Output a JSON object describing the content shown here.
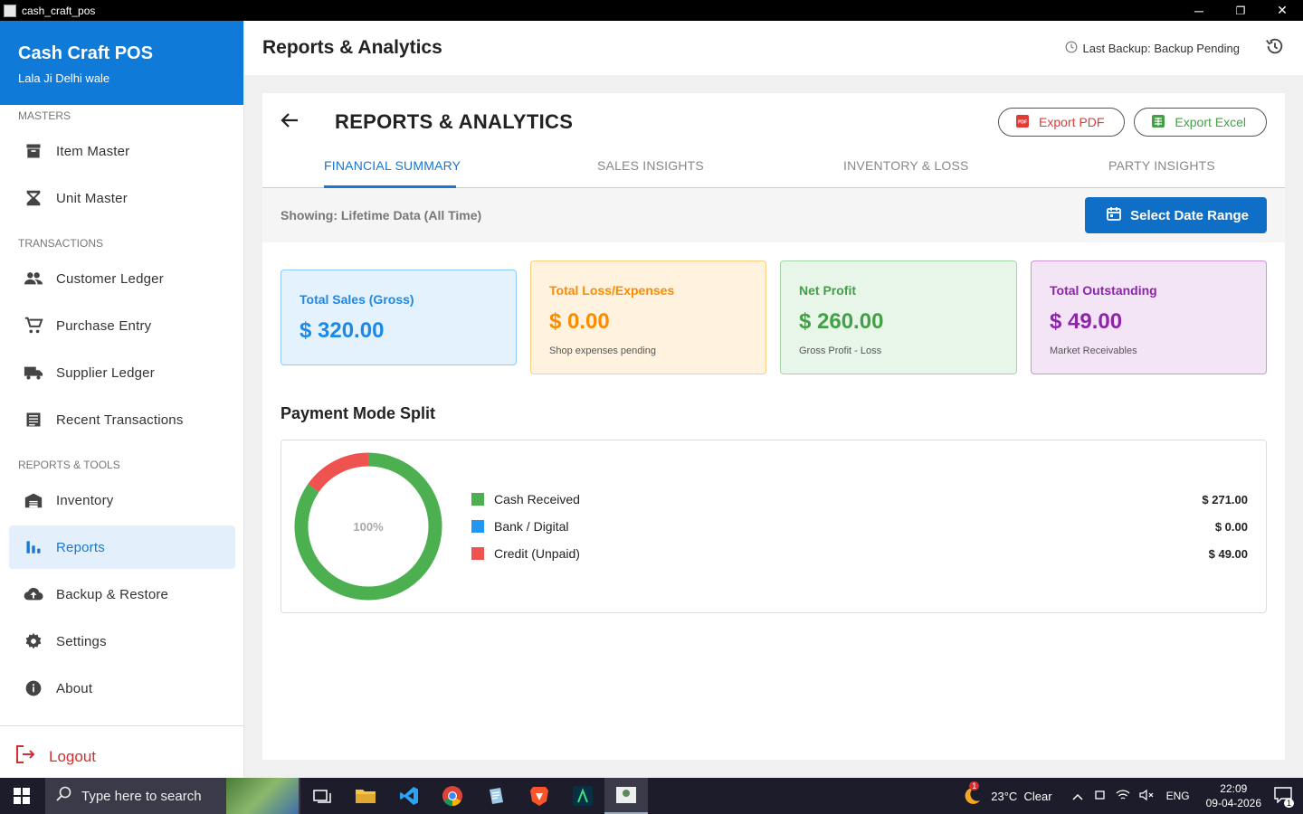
{
  "window": {
    "title": "cash_craft_pos",
    "minimize_label": "─",
    "restore_label": "❐",
    "close_label": "✕"
  },
  "sidebar": {
    "app_name": "Cash Craft POS",
    "shop_name": "Lala Ji Delhi wale",
    "sections": {
      "masters": "MASTERS",
      "transactions": "TRANSACTIONS",
      "reports_tools": "REPORTS & TOOLS"
    },
    "items": [
      {
        "label": "Item Master",
        "icon": "archive-icon"
      },
      {
        "label": "Unit Master",
        "icon": "scale-icon"
      },
      {
        "label": "Customer Ledger",
        "icon": "people-icon"
      },
      {
        "label": "Purchase Entry",
        "icon": "cart-icon"
      },
      {
        "label": "Supplier Ledger",
        "icon": "truck-icon"
      },
      {
        "label": "Recent Transactions",
        "icon": "list-icon"
      },
      {
        "label": "Inventory",
        "icon": "warehouse-icon"
      },
      {
        "label": "Reports",
        "icon": "bar-chart-icon"
      },
      {
        "label": "Backup & Restore",
        "icon": "cloud-upload-icon"
      },
      {
        "label": "Settings",
        "icon": "gear-icon"
      },
      {
        "label": "About",
        "icon": "info-icon"
      }
    ],
    "active_item": "Reports",
    "logout_label": "Logout"
  },
  "header": {
    "title": "Reports & Analytics",
    "backup_status": "Last Backup: Backup Pending"
  },
  "panel": {
    "title": "REPORTS & ANALYTICS",
    "export_pdf": "Export PDF",
    "export_excel": "Export Excel",
    "tabs": [
      "FINANCIAL SUMMARY",
      "SALES INSIGHTS",
      "INVENTORY & LOSS",
      "PARTY INSIGHTS"
    ],
    "active_tab": "FINANCIAL SUMMARY",
    "showing": "Showing: Lifetime Data (All Time)",
    "date_range_label": "Select Date Range"
  },
  "cards": [
    {
      "label": "Total Sales (Gross)",
      "value": "$ 320.00",
      "note": "",
      "color": "#1e88e5",
      "bg": "#e3f2fd",
      "border": "#90caf9"
    },
    {
      "label": "Total Loss/Expenses",
      "value": "$ 0.00",
      "note": "Shop expenses pending",
      "color": "#fb8c00",
      "bg": "#fff3e0",
      "border": "#ffcc80"
    },
    {
      "label": "Net Profit",
      "value": "$ 260.00",
      "note": "Gross Profit - Loss",
      "color": "#43a047",
      "bg": "#e8f5e9",
      "border": "#a5d6a7"
    },
    {
      "label": "Total Outstanding",
      "value": "$ 49.00",
      "note": "Market Receivables",
      "color": "#8e24aa",
      "bg": "#f3e5f5",
      "border": "#ce93d8"
    }
  ],
  "payment_split": {
    "title": "Payment Mode Split",
    "center_label": "100%",
    "items": [
      {
        "label": "Cash Received",
        "value": "$ 271.00",
        "amount": 271,
        "color": "#4caf50"
      },
      {
        "label": "Bank / Digital",
        "value": "$ 0.00",
        "amount": 0,
        "color": "#2196f3"
      },
      {
        "label": "Credit (Unpaid)",
        "value": "$ 49.00",
        "amount": 49,
        "color": "#ef5350"
      }
    ]
  },
  "taskbar": {
    "search_placeholder": "Type here to search",
    "weather": "23°C  Clear",
    "weather_badge": "1",
    "language": "ENG",
    "time": "22:09",
    "date": "09-04-2026",
    "notification_count": "1"
  }
}
